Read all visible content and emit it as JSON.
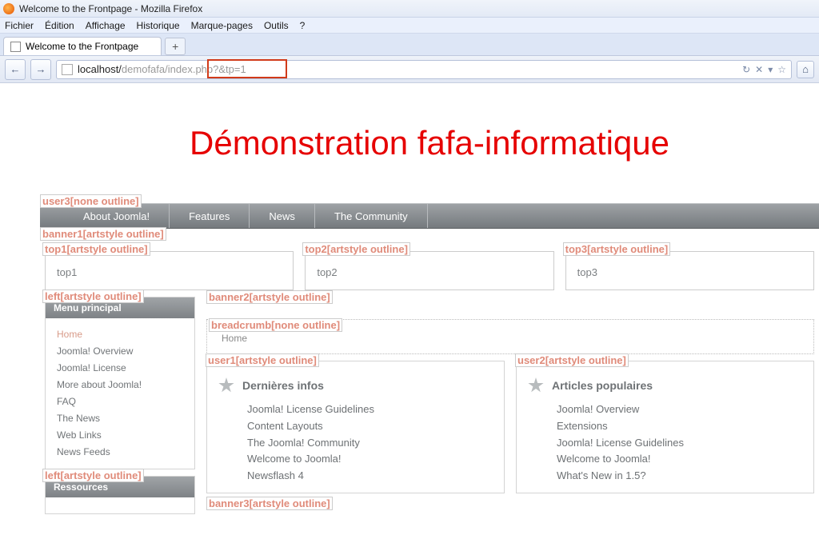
{
  "window": {
    "title": "Welcome to the Frontpage - Mozilla Firefox"
  },
  "menu": {
    "items": [
      "Fichier",
      "Édition",
      "Affichage",
      "Historique",
      "Marque-pages",
      "Outils",
      "?"
    ]
  },
  "tab": {
    "title": "Welcome to the Frontpage",
    "newtab": "+"
  },
  "nav": {
    "back": "←",
    "forward": "→",
    "url_host": "localhost/",
    "url_grey1": "demofafa/",
    "url_rest": "index.php?&tp=1",
    "refresh": "↻",
    "stop": "✕",
    "dropdown": "▾",
    "star": "☆"
  },
  "header": {
    "title": "Démonstration fafa-informatique"
  },
  "labels": {
    "user3": "user3[none outline]",
    "banner1": "banner1",
    "banner1b": "[artstyle outline]",
    "top1": "top1[artstyle outline]",
    "top2": "top2[artstyle outline]",
    "top3": "top3[artstyle outline]",
    "left": "left[artstyle outline]",
    "left2": "left[artstyle outline]",
    "banner2": "banner2",
    "banner2b": "[artstyle outline]",
    "banner3": "banner3",
    "banner3b": "[artstyle outline]",
    "breadcrumb": "breadcrumb[none outline]",
    "user1": "user1[artstyle outline]",
    "user2": "user2[artstyle outline]"
  },
  "topnav": {
    "items": [
      "About Joomla!",
      "Features",
      "News",
      "The Community"
    ]
  },
  "tops": {
    "t1": "top1",
    "t2": "top2",
    "t3": "top3"
  },
  "sidebar": {
    "menu_title": "Menu principal",
    "menu_items": [
      "Home",
      "Joomla! Overview",
      "Joomla! License",
      "More about Joomla!",
      "FAQ",
      "The News",
      "Web Links",
      "News Feeds"
    ],
    "resources_title": "Ressources"
  },
  "breadcrumb": {
    "home": "Home"
  },
  "user1": {
    "title": "Dernières infos",
    "items": [
      "Joomla! License Guidelines",
      "Content Layouts",
      "The Joomla! Community",
      "Welcome to Joomla!",
      "Newsflash 4"
    ]
  },
  "user2": {
    "title": "Articles populaires",
    "items": [
      "Joomla! Overview",
      "Extensions",
      "Joomla! License Guidelines",
      "Welcome to Joomla!",
      "What's New in 1.5?"
    ]
  }
}
